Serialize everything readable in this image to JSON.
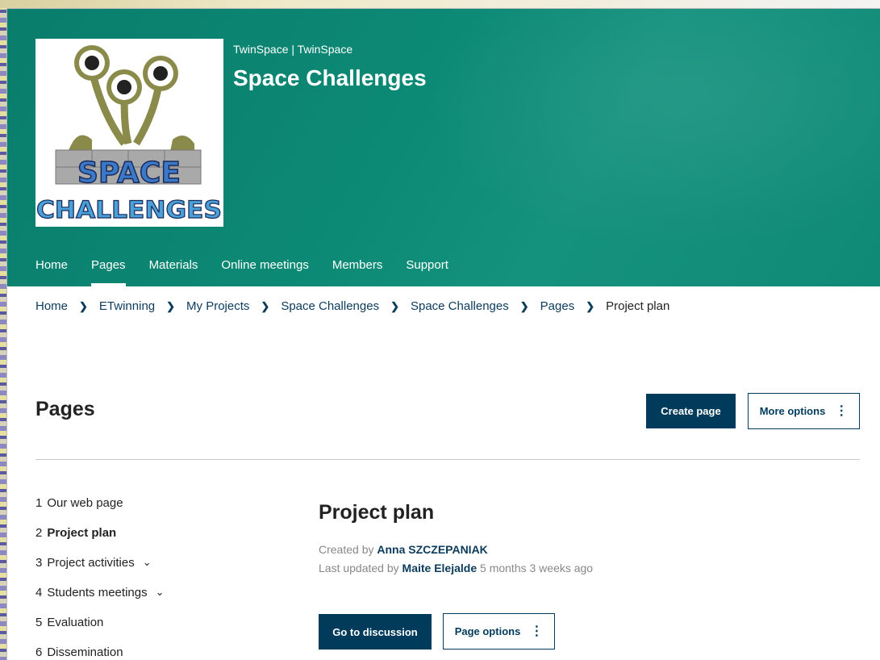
{
  "header": {
    "site_crumb": "TwinSpace | TwinSpace",
    "project_title": "Space Challenges",
    "logo_text_top": "SPACE",
    "logo_text_bottom": "CHALLENGES"
  },
  "nav": {
    "items": [
      "Home",
      "Pages",
      "Materials",
      "Online meetings",
      "Members",
      "Support"
    ],
    "active": "Pages"
  },
  "breadcrumb": [
    "Home",
    "ETwinning",
    "My Projects",
    "Space Challenges",
    "Space Challenges",
    "Pages",
    "Project plan"
  ],
  "pages": {
    "title": "Pages",
    "create_button": "Create page",
    "more_options_button": "More options"
  },
  "sidebar": {
    "items": [
      {
        "num": "1",
        "label": "Our web page",
        "expandable": false
      },
      {
        "num": "2",
        "label": "Project plan",
        "expandable": false
      },
      {
        "num": "3",
        "label": "Project activities",
        "expandable": true
      },
      {
        "num": "4",
        "label": "Students meetings",
        "expandable": true
      },
      {
        "num": "5",
        "label": "Evaluation",
        "expandable": false
      },
      {
        "num": "6",
        "label": "Dissemination",
        "expandable": false
      }
    ],
    "active_index": 1
  },
  "content": {
    "title": "Project plan",
    "created_prefix": "Created by",
    "created_by": "Anna SZCZEPANIAK",
    "updated_prefix": "Last updated by",
    "updated_by": "Maite Elejalde",
    "updated_ago": "5 months 3 weeks ago",
    "discussion_button": "Go to discussion",
    "page_options_button": "Page options"
  },
  "colors": {
    "header_green": "#0c8a76",
    "primary_navy": "#003b5c"
  }
}
